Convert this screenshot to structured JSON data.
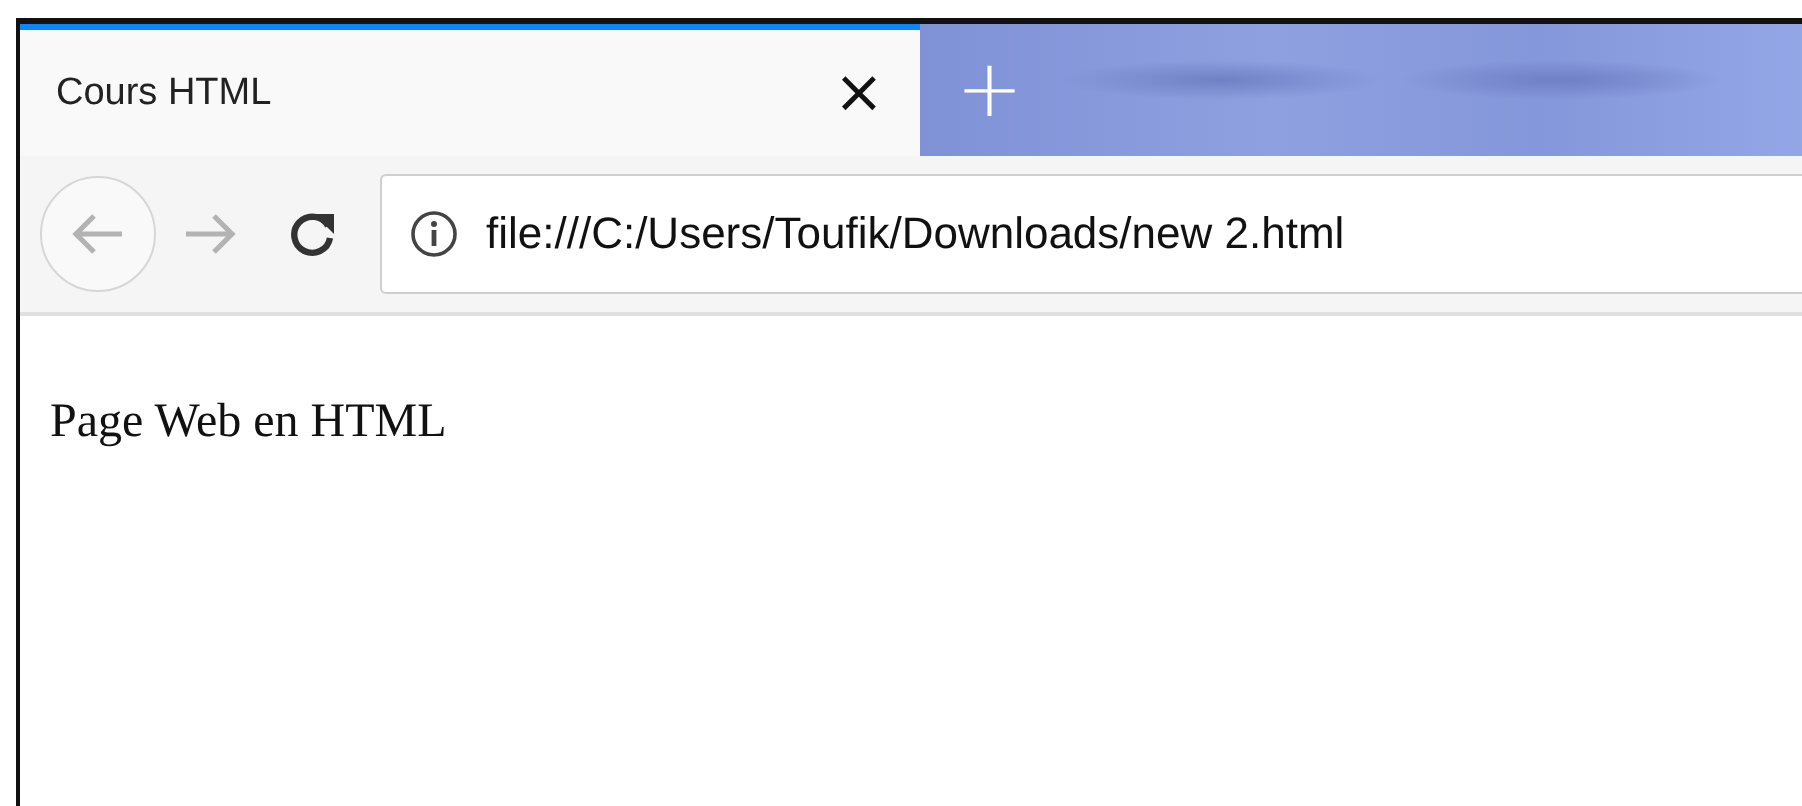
{
  "tabs": [
    {
      "title": "Cours HTML",
      "close": "×",
      "selected": true
    }
  ],
  "new_tab": "+",
  "toolbar": {
    "back": {
      "disabled": true
    },
    "forward": {
      "disabled": true
    },
    "url": "file:///C:/Users/Toufik/Downloads/new 2.html"
  },
  "page": {
    "text": "Page Web en HTML"
  }
}
